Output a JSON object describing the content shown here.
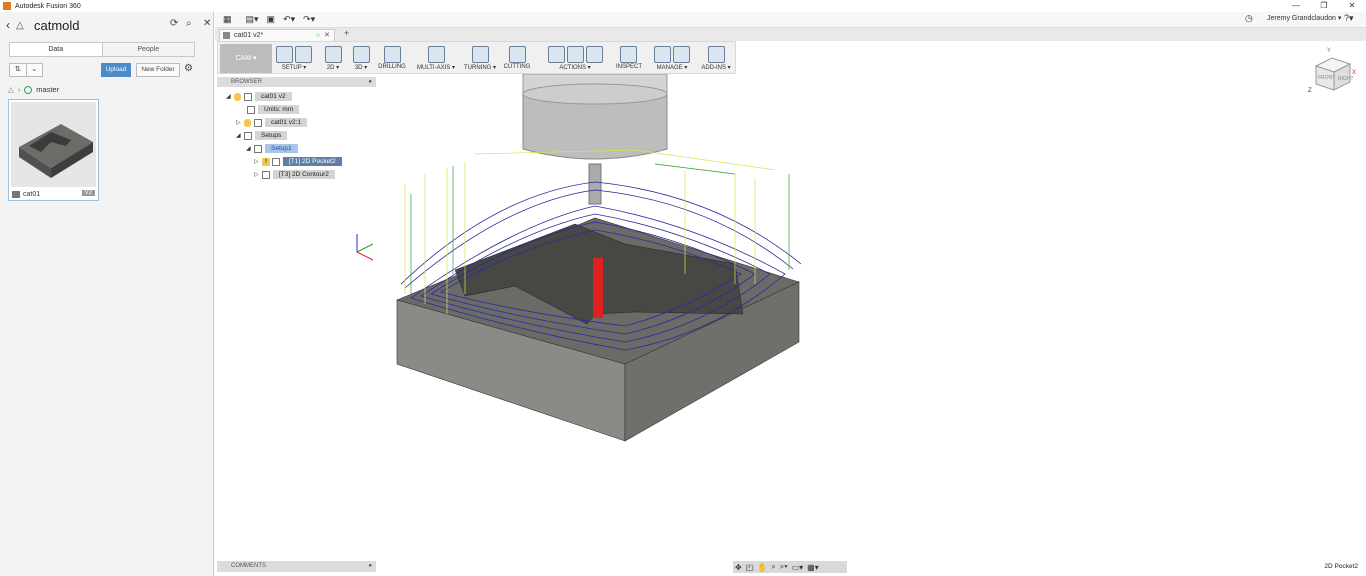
{
  "window": {
    "title": "Autodesk Fusion 360"
  },
  "data_panel": {
    "project_title": "catmold",
    "tabs": [
      "Data",
      "People"
    ],
    "upload_label": "Upload",
    "new_folder_label": "New Folder",
    "branch": "master",
    "file": {
      "name": "cat01",
      "version": "V2"
    }
  },
  "appbar": {
    "user": "Jeremy Grandclaudon ▾"
  },
  "document": {
    "tab_title": "cat01 v2*"
  },
  "toolbar": {
    "workspace": "CAM ▾",
    "groups": [
      "SETUP ▾",
      "2D ▾",
      "3D ▾",
      "DRILLING",
      "MULTI-AXIS ▾",
      "TURNING ▾",
      "CUTTING",
      "ACTIONS ▾",
      "INSPECT",
      "MANAGE ▾",
      "ADD-INS ▾"
    ]
  },
  "browser": {
    "title": "BROWSER",
    "root": "cat01 v2",
    "units": "Units: mm",
    "component": "cat01 v2:1",
    "setups": "Setups",
    "setup": "Setup1",
    "op1": "[T1] 2D Pocket2",
    "op2": "[T3] 2D Contour2"
  },
  "comments": {
    "title": "COMMENTS"
  },
  "status": {
    "selected_op": "2D Pocket2"
  },
  "viewcube": {
    "front": "FRONT",
    "right": "RIGHT",
    "x": "X",
    "y": "Y",
    "z": "Z"
  },
  "colors": {
    "accent": "#4a8bc8",
    "toolpath": "#2a2aa0",
    "rapid": "#e8e84a",
    "lead": "#2ea02e",
    "tool_path_active": "#e02020"
  }
}
